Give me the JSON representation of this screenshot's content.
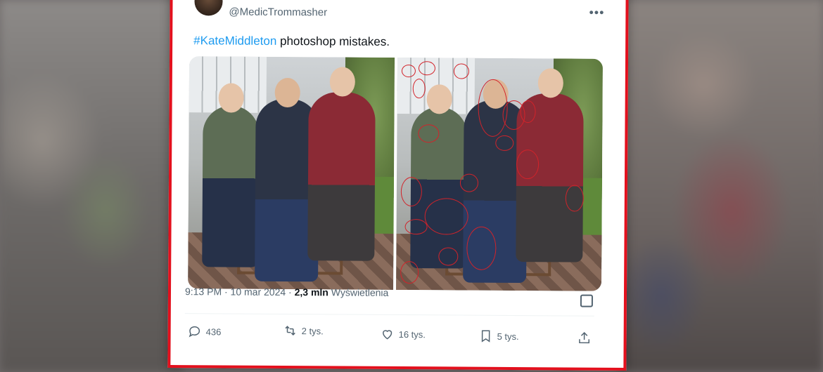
{
  "tweet": {
    "handle": "@MedicTrommasher",
    "hashtag": "#KateMiddleton",
    "text": " photoshop mistakes.",
    "timestamp": "9:13 PM · 10 mar 2024 · ",
    "views_count": "2,3 mln",
    "views_label": " Wyświetlenia"
  },
  "actions": {
    "reply_count": "436",
    "retweet_count": "2 tys.",
    "like_count": "16 tys.",
    "bookmark_count": "5 tys."
  },
  "colors": {
    "frame": "#e3101d",
    "link": "#1d9bf0",
    "muted": "#536471",
    "annotation": "#d2232a"
  },
  "icons": [
    "more-icon",
    "reply-icon",
    "retweet-icon",
    "like-icon",
    "bookmark-icon",
    "share-icon",
    "analytics-icon"
  ]
}
